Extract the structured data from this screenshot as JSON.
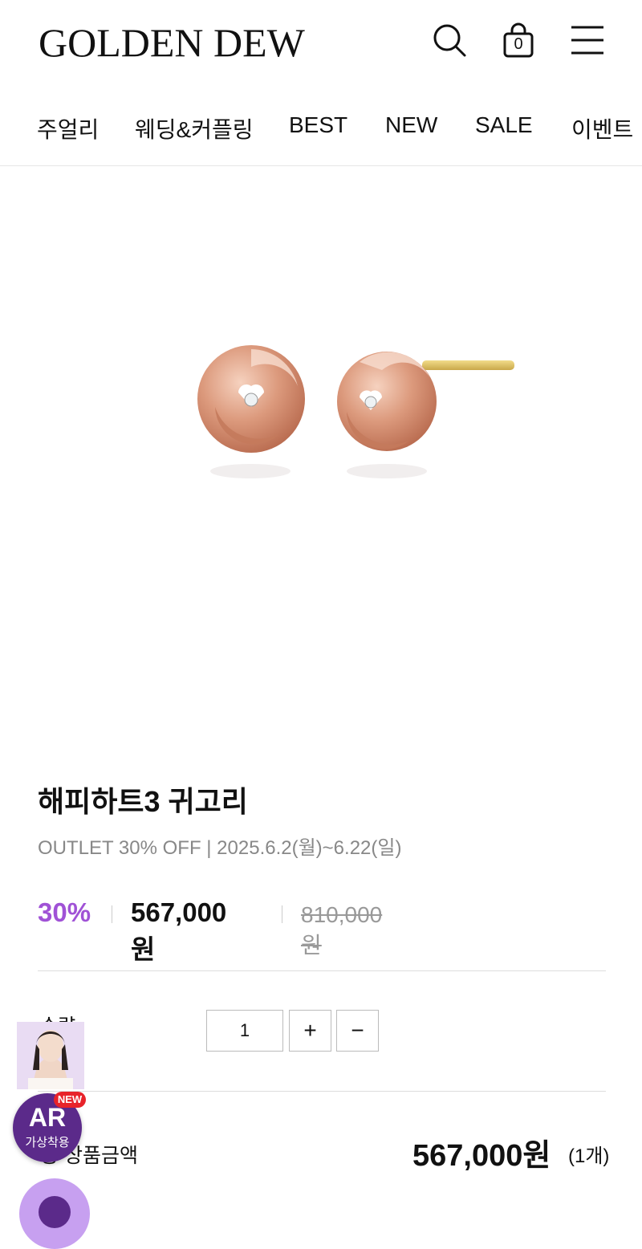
{
  "header": {
    "logo": "GOLDEN DEW",
    "icons": [
      "search-icon",
      "shopping-bag-icon",
      "menu-icon"
    ],
    "cart_count": "0"
  },
  "nav": {
    "items": [
      "주얼리",
      "웨딩&커플링",
      "BEST",
      "NEW",
      "SALE",
      "이벤트"
    ]
  },
  "product": {
    "title": "해피하트3 귀고리",
    "subtitle": "OUTLET 30% OFF | 2025.6.2(월)~6.22(일)",
    "discount": "30%",
    "price": "567,000원",
    "original_price": "810,000원",
    "accent_color": "#a052d6"
  },
  "quantity": {
    "label": "수량",
    "value": "1",
    "plus": "+",
    "minus": "−"
  },
  "total": {
    "label": "총 상품금액",
    "price": "567,000원",
    "count": "(1개)"
  },
  "ar": {
    "badge": "NEW",
    "main": "AR",
    "sub": "가상착용"
  }
}
